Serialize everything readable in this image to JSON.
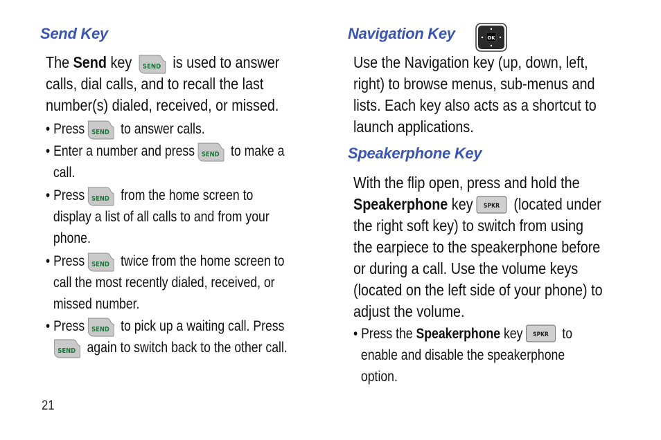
{
  "page_number": "21",
  "left_column": {
    "send_key": {
      "heading": "Send Key",
      "intro": {
        "pre": "The ",
        "bold": "Send",
        "mid": " key",
        "post": " is used to answer",
        "line2": "calls, dial calls, and to recall the last",
        "line3": "number(s) dialed, received, or missed."
      },
      "bullets": [
        {
          "pre": "• Press",
          "post": " to answer calls."
        },
        {
          "pre": "• Enter a number and press",
          "post": " to make a",
          "line2": "call."
        },
        {
          "pre": "• Press",
          "post": " from the home screen to",
          "line2": "display a list of all calls to and from your",
          "line3": "phone."
        },
        {
          "pre": "• Press",
          "post": " twice from the home screen to",
          "line2": "call the most recently dialed, received, or",
          "line3": "missed number."
        },
        {
          "pre": "• Press",
          "post": " to pick up a waiting call. Press",
          "line2": " again to switch back to the other call."
        }
      ],
      "icon_label": "SEND"
    }
  },
  "right_column": {
    "navigation_key": {
      "heading": "Navigation Key",
      "icon_label": "OK",
      "lines": [
        "Use the Navigation key (up, down, left,",
        "right) to browse menus, sub-menus and",
        "lists. Each key also acts as a shortcut to",
        "launch applications."
      ]
    },
    "speakerphone_key": {
      "heading": "Speakerphone Key",
      "icon_label": "SPKR",
      "line1": "With the flip open, press and hold the",
      "line2_bold": "Speakerphone",
      "line2_mid": " key",
      "line2_post": " (located under",
      "lines": [
        "the right soft key) to switch from using",
        "the earpiece to the speakerphone before",
        "or during a call. Use the volume keys",
        "(located on the left side of your phone) to",
        "adjust the volume."
      ],
      "bullet": {
        "pre": "• Press the ",
        "bold": "Speakerphone",
        "mid": " key",
        "post": " to",
        "line2": "enable and disable the speakerphone",
        "line3": "option."
      }
    }
  },
  "colors": {
    "heading": "#3a55b0",
    "send_text": "#1a7a3a",
    "key_gray": "#c8c8c8",
    "nav_key_bg": "#2b2b2b"
  }
}
